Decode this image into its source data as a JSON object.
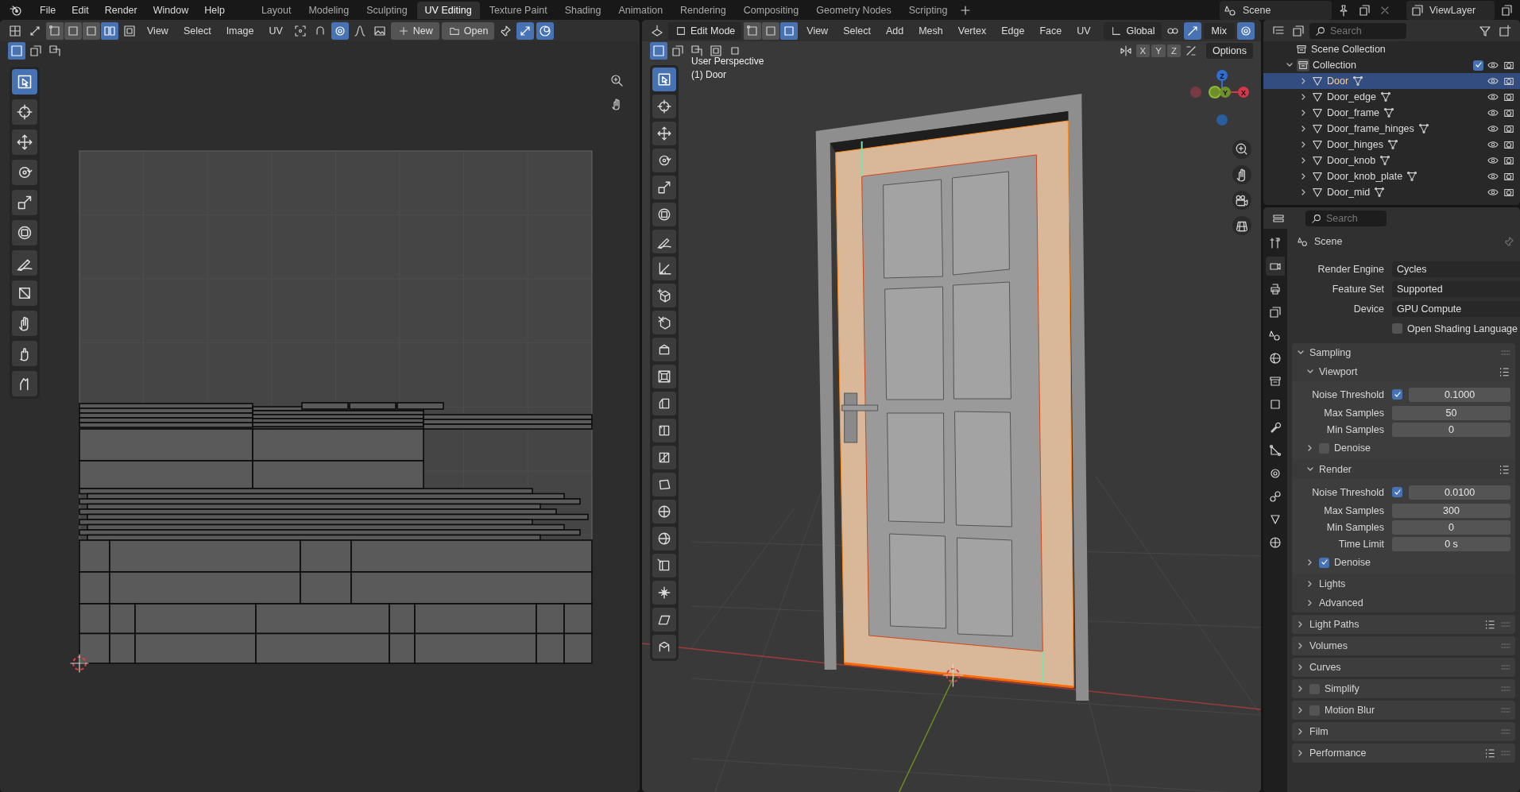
{
  "menu_bar": [
    "File",
    "Edit",
    "Render",
    "Window",
    "Help"
  ],
  "workspace_tabs": [
    {
      "label": "Layout",
      "selected": false
    },
    {
      "label": "Modeling",
      "selected": false
    },
    {
      "label": "Sculpting",
      "selected": false
    },
    {
      "label": "UV Editing",
      "selected": true
    },
    {
      "label": "Texture Paint",
      "selected": false
    },
    {
      "label": "Shading",
      "selected": false
    },
    {
      "label": "Animation",
      "selected": false
    },
    {
      "label": "Rendering",
      "selected": false
    },
    {
      "label": "Compositing",
      "selected": false
    },
    {
      "label": "Geometry Nodes",
      "selected": false
    },
    {
      "label": "Scripting",
      "selected": false
    }
  ],
  "scene": "Scene",
  "view_layer": "ViewLayer",
  "uv_editor": {
    "menus": [
      "View",
      "Select",
      "Image",
      "UV"
    ],
    "new_button": "New",
    "open_button": "Open",
    "select_modes": [
      {
        "kind": "vertex",
        "selected": false
      },
      {
        "kind": "edge",
        "selected": false
      },
      {
        "kind": "face",
        "selected": false
      },
      {
        "kind": "island",
        "selected": true
      }
    ],
    "tools": [
      {
        "kind": "select",
        "selected": true
      },
      {
        "kind": "cursor",
        "selected": false
      },
      {
        "kind": "move",
        "selected": false
      },
      {
        "kind": "rotate",
        "selected": false
      },
      {
        "kind": "scale",
        "selected": false
      },
      {
        "kind": "transform",
        "selected": false
      },
      {
        "kind": "annotate",
        "selected": false
      },
      {
        "kind": "rip",
        "selected": false
      },
      {
        "kind": "grab",
        "selected": false
      },
      {
        "kind": "relax",
        "selected": false
      },
      {
        "kind": "pinch",
        "selected": false
      }
    ]
  },
  "viewport": {
    "mode": "Edit Mode",
    "menus": [
      "View",
      "Select",
      "Add",
      "Mesh",
      "Vertex",
      "Edge",
      "Face",
      "UV"
    ],
    "orientation": "Global",
    "snap_target": "Mix",
    "axis_toggles": [
      "X",
      "Y",
      "Z"
    ],
    "options": "Options",
    "view_name": "User Perspective",
    "object_label": "(1) Door",
    "gizmo_axes": {
      "z": "Z",
      "y": "Y",
      "x": "X"
    },
    "select_modes": [
      {
        "kind": "vertex",
        "selected": false
      },
      {
        "kind": "edge",
        "selected": false
      },
      {
        "kind": "face",
        "selected": true
      }
    ],
    "tools": [
      {
        "kind": "select",
        "selected": true
      },
      {
        "kind": "cursor",
        "selected": false
      },
      {
        "kind": "move",
        "selected": false
      },
      {
        "kind": "rotate",
        "selected": false
      },
      {
        "kind": "scale",
        "selected": false
      },
      {
        "kind": "transform",
        "selected": false
      },
      {
        "kind": "annotate",
        "selected": false
      },
      {
        "kind": "measure",
        "selected": false
      },
      {
        "kind": "add-cube",
        "selected": false
      },
      {
        "kind": "cube-cut",
        "selected": false
      },
      {
        "kind": "extrude",
        "selected": false
      },
      {
        "kind": "inset",
        "selected": false
      },
      {
        "kind": "bevel",
        "selected": false
      },
      {
        "kind": "loop-cut",
        "selected": false
      },
      {
        "kind": "knife",
        "selected": false
      },
      {
        "kind": "poly-build",
        "selected": false
      },
      {
        "kind": "spin",
        "selected": false
      },
      {
        "kind": "smooth",
        "selected": false
      },
      {
        "kind": "edge-slide",
        "selected": false
      },
      {
        "kind": "shrink",
        "selected": false
      },
      {
        "kind": "shear",
        "selected": false
      },
      {
        "kind": "rip-region",
        "selected": false
      }
    ]
  },
  "outliner": {
    "search_placeholder": "Search",
    "scene_collection": "Scene Collection",
    "collection": {
      "label": "Collection",
      "expanded": true,
      "checked": true,
      "children": [
        {
          "label": "Door",
          "selected": true
        },
        {
          "label": "Door_edge",
          "selected": false
        },
        {
          "label": "Door_frame",
          "selected": false
        },
        {
          "label": "Door_frame_hinges",
          "selected": false
        },
        {
          "label": "Door_hinges",
          "selected": false
        },
        {
          "label": "Door_knob",
          "selected": false
        },
        {
          "label": "Door_knob_plate",
          "selected": false
        },
        {
          "label": "Door_mid",
          "selected": false
        }
      ]
    }
  },
  "properties": {
    "search_placeholder": "Search",
    "context": "Scene",
    "tabs": [
      {
        "kind": "tool",
        "selected": false
      },
      {
        "kind": "render",
        "selected": true
      },
      {
        "kind": "output",
        "selected": false
      },
      {
        "kind": "view-layer",
        "selected": false
      },
      {
        "kind": "scene",
        "selected": false
      },
      {
        "kind": "world",
        "selected": false
      },
      {
        "kind": "collection",
        "selected": false
      },
      {
        "kind": "object",
        "selected": false
      },
      {
        "kind": "modifier",
        "selected": false
      },
      {
        "kind": "particles",
        "selected": false
      },
      {
        "kind": "physics",
        "selected": false
      },
      {
        "kind": "constraint",
        "selected": false
      },
      {
        "kind": "mesh-data",
        "selected": false
      },
      {
        "kind": "material",
        "selected": false
      }
    ],
    "fields": [
      {
        "label": "Render Engine",
        "value": "Cycles"
      },
      {
        "label": "Feature Set",
        "value": "Supported"
      },
      {
        "label": "Device",
        "value": "GPU Compute"
      }
    ],
    "osl": {
      "label": "Open Shading Language",
      "checked": false
    },
    "sampling": {
      "label": "Sampling",
      "expanded": true,
      "subpanels": [
        {
          "label": "Viewport",
          "expanded": true,
          "noise": {
            "label": "Noise Threshold",
            "checked": true,
            "value": "0.1000"
          },
          "rows": [
            {
              "label": "Max Samples",
              "value": "50"
            },
            {
              "label": "Min Samples",
              "value": "0"
            }
          ],
          "denoise": {
            "label": "Denoise",
            "checked": false
          }
        },
        {
          "label": "Render",
          "expanded": true,
          "noise": {
            "label": "Noise Threshold",
            "checked": true,
            "value": "0.0100"
          },
          "rows": [
            {
              "label": "Max Samples",
              "value": "300"
            },
            {
              "label": "Min Samples",
              "value": "0"
            },
            {
              "label": "Time Limit",
              "value": "0 s"
            }
          ],
          "denoise": {
            "label": "Denoise",
            "checked": true
          }
        }
      ],
      "more": [
        {
          "label": "Lights",
          "expanded": false
        },
        {
          "label": "Advanced",
          "expanded": false
        }
      ]
    },
    "panels": [
      {
        "label": "Light Paths",
        "kind": "plain",
        "presets": true
      },
      {
        "label": "Volumes",
        "kind": "plain",
        "presets": false
      },
      {
        "label": "Curves",
        "kind": "plain",
        "presets": false
      },
      {
        "label": "Simplify",
        "kind": "toggle",
        "checked": false,
        "presets": false
      },
      {
        "label": "Motion Blur",
        "kind": "toggle",
        "checked": false,
        "presets": false
      },
      {
        "label": "Film",
        "kind": "plain",
        "presets": false
      },
      {
        "label": "Performance",
        "kind": "plain",
        "presets": true
      }
    ]
  }
}
